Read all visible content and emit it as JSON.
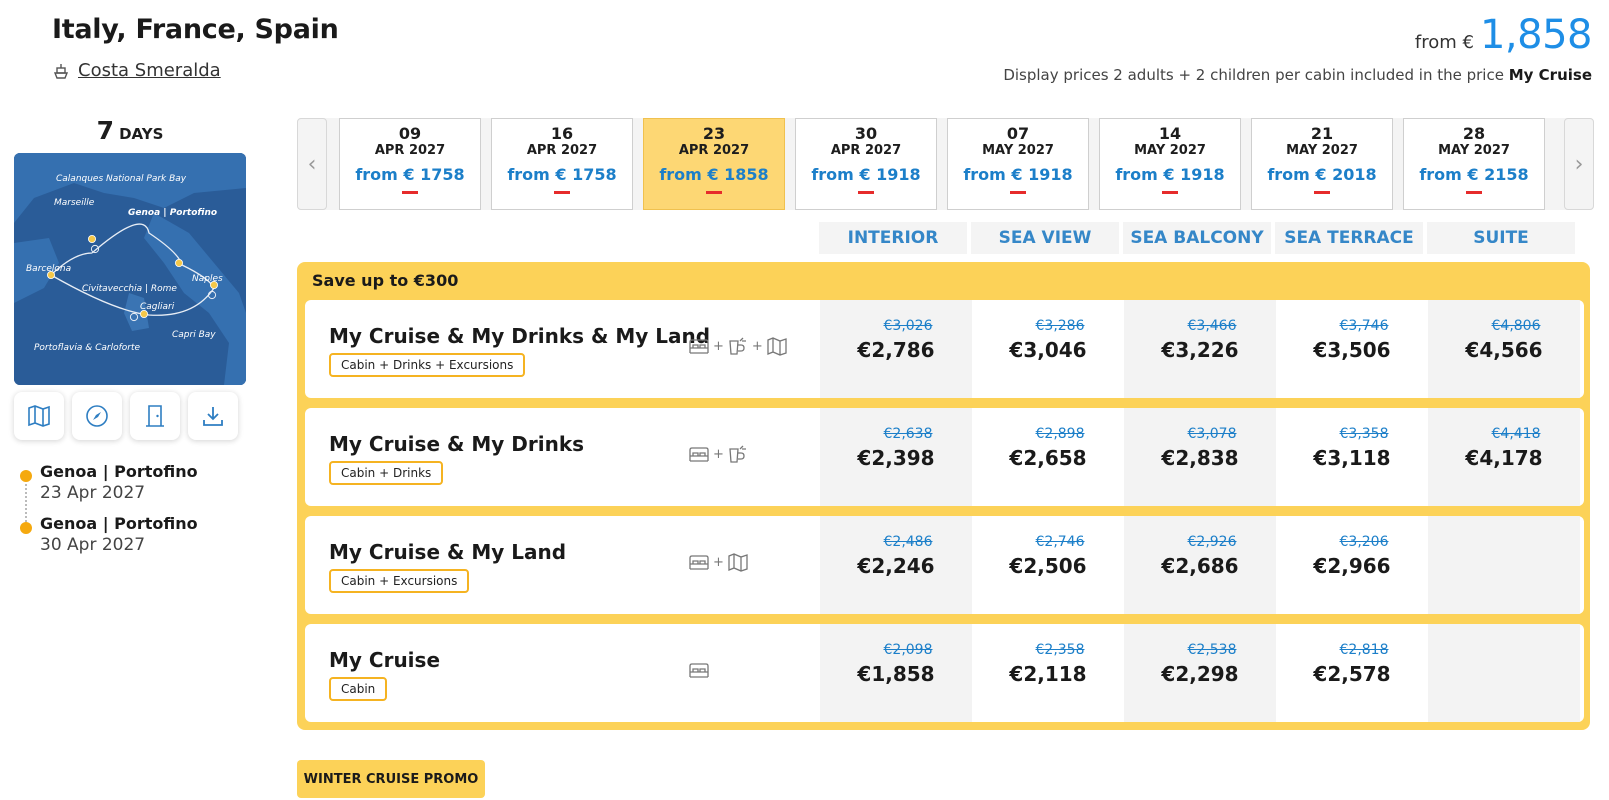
{
  "header": {
    "title": "Italy, France, Spain",
    "ship": "Costa Smeralda",
    "price_from_label": "from €",
    "price_from_value": "1,858",
    "price_note": "Display prices 2 adults + 2 children per cabin included in the price",
    "price_note_bold": "My Cruise"
  },
  "sidebar": {
    "days_number": "7",
    "days_unit": "DAYS",
    "map_labels": {
      "calanques": "Calanques National Park Bay",
      "marseille": "Marseille",
      "genoa": "Genoa | Portofino",
      "barcelona": "Barcelona",
      "civitavecchia": "Civitavecchia | Rome",
      "naples": "Naples",
      "cagliari": "Cagliari",
      "capri": "Capri Bay",
      "portoflavia": "Portoflavia & Carloforte"
    },
    "tools": [
      "map-icon",
      "compass-icon",
      "door-icon",
      "download-icon"
    ],
    "ports": [
      {
        "name": "Genoa | Portofino",
        "date": "23 Apr 2027"
      },
      {
        "name": "Genoa | Portofino",
        "date": "30 Apr 2027"
      }
    ]
  },
  "dates": [
    {
      "day": "09",
      "month": "APR 2027",
      "price": "from € 1758",
      "selected": false
    },
    {
      "day": "16",
      "month": "APR 2027",
      "price": "from € 1758",
      "selected": false
    },
    {
      "day": "23",
      "month": "APR 2027",
      "price": "from € 1858",
      "selected": true
    },
    {
      "day": "30",
      "month": "APR 2027",
      "price": "from € 1918",
      "selected": false
    },
    {
      "day": "07",
      "month": "MAY 2027",
      "price": "from € 1918",
      "selected": false
    },
    {
      "day": "14",
      "month": "MAY 2027",
      "price": "from € 1918",
      "selected": false
    },
    {
      "day": "21",
      "month": "MAY 2027",
      "price": "from € 2018",
      "selected": false
    },
    {
      "day": "28",
      "month": "MAY 2027",
      "price": "from € 2158",
      "selected": false
    }
  ],
  "nav": {
    "prev": "‹",
    "next": "›"
  },
  "cabin_types": [
    "INTERIOR",
    "SEA VIEW",
    "SEA BALCONY",
    "SEA TERRACE",
    "SUITE"
  ],
  "offer": {
    "title": "Save up to €300",
    "packages": [
      {
        "name": "My Cruise & My Drinks & My Land",
        "badge": "Cabin + Drinks + Excursions",
        "icons": [
          "bed-icon",
          "drinks-icon",
          "map-icon"
        ],
        "prices": [
          {
            "old": "€3,026",
            "now": "€2,786"
          },
          {
            "old": "€3,286",
            "now": "€3,046"
          },
          {
            "old": "€3,466",
            "now": "€3,226"
          },
          {
            "old": "€3,746",
            "now": "€3,506"
          },
          {
            "old": "€4,806",
            "now": "€4,566"
          }
        ]
      },
      {
        "name": "My Cruise & My Drinks",
        "badge": "Cabin + Drinks",
        "icons": [
          "bed-icon",
          "drinks-icon"
        ],
        "prices": [
          {
            "old": "€2,638",
            "now": "€2,398"
          },
          {
            "old": "€2,898",
            "now": "€2,658"
          },
          {
            "old": "€3,078",
            "now": "€2,838"
          },
          {
            "old": "€3,358",
            "now": "€3,118"
          },
          {
            "old": "€4,418",
            "now": "€4,178"
          }
        ]
      },
      {
        "name": "My Cruise & My Land",
        "badge": "Cabin + Excursions",
        "icons": [
          "bed-icon",
          "map-icon"
        ],
        "prices": [
          {
            "old": "€2,486",
            "now": "€2,246"
          },
          {
            "old": "€2,746",
            "now": "€2,506"
          },
          {
            "old": "€2,926",
            "now": "€2,686"
          },
          {
            "old": "€3,206",
            "now": "€2,966"
          },
          {
            "old": "",
            "now": ""
          }
        ]
      },
      {
        "name": "My Cruise",
        "badge": "Cabin",
        "icons": [
          "bed-icon"
        ],
        "prices": [
          {
            "old": "€2,098",
            "now": "€1,858"
          },
          {
            "old": "€2,358",
            "now": "€2,118"
          },
          {
            "old": "€2,538",
            "now": "€2,298"
          },
          {
            "old": "€2,818",
            "now": "€2,578"
          },
          {
            "old": "",
            "now": ""
          }
        ]
      }
    ]
  },
  "promo": "WINTER CRUISE PROMO",
  "colors": {
    "accent_blue": "#1e8ee6",
    "price_blue": "#1c7fc9",
    "yellow": "#fcd258",
    "selected_date": "#fdd774",
    "map_sea": "#2a5c98"
  }
}
